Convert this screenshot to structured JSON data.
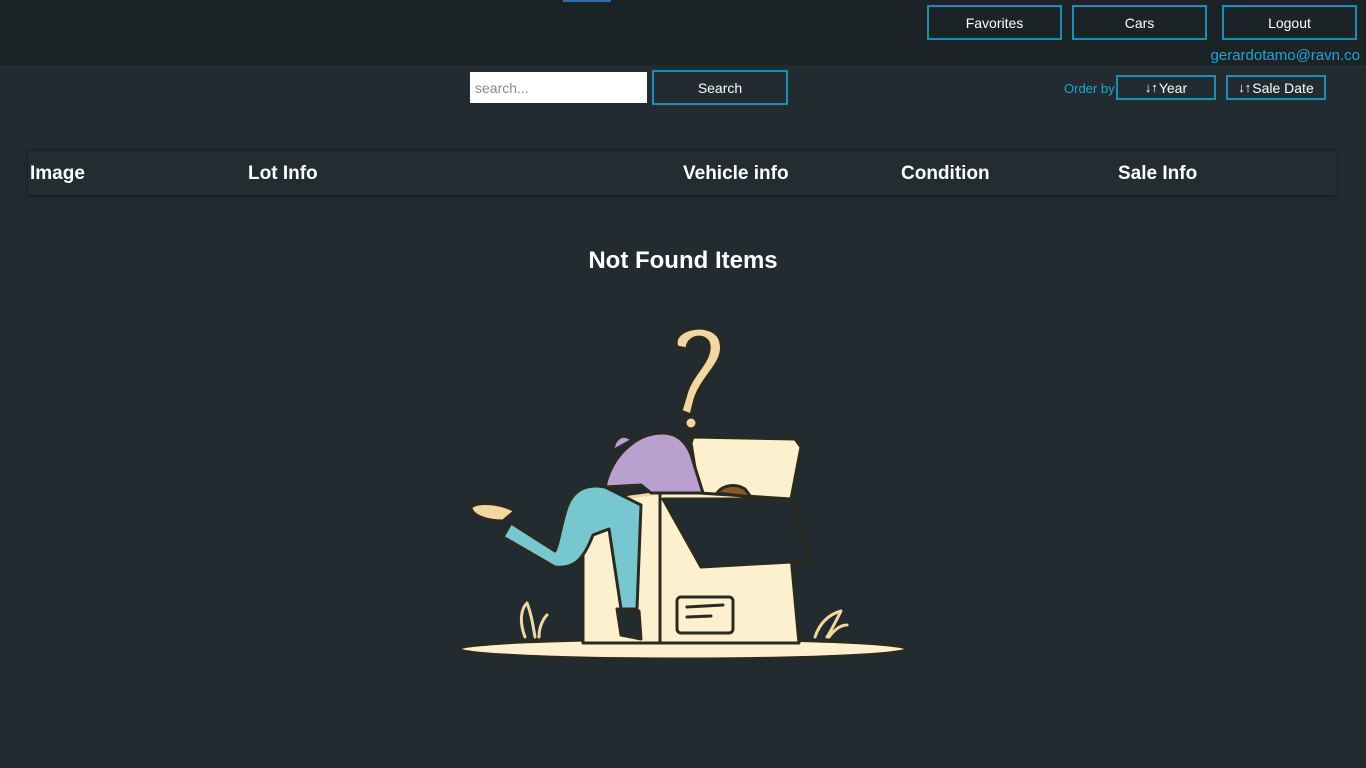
{
  "nav": {
    "favorites_label": "Favorites",
    "cars_label": "Cars",
    "logout_label": "Logout",
    "user_email": "gerardotamo@ravn.co"
  },
  "search": {
    "placeholder": "search...",
    "value": "",
    "button_label": "Search"
  },
  "order": {
    "label": "Order by",
    "sort_icon": "sort-arrows-icon",
    "year_label": "Year",
    "sale_date_label": "Sale Date"
  },
  "table": {
    "columns": [
      "Image",
      "Lot Info",
      "Vehicle info",
      "Condition",
      "Sale Info"
    ]
  },
  "empty_state": {
    "title": "Not Found Items",
    "illustration": "person-searching-box-illustration"
  },
  "colors": {
    "background": "#222b30",
    "topbar": "#1c2327",
    "accent": "#1591b8",
    "link": "#1aa7d6"
  }
}
